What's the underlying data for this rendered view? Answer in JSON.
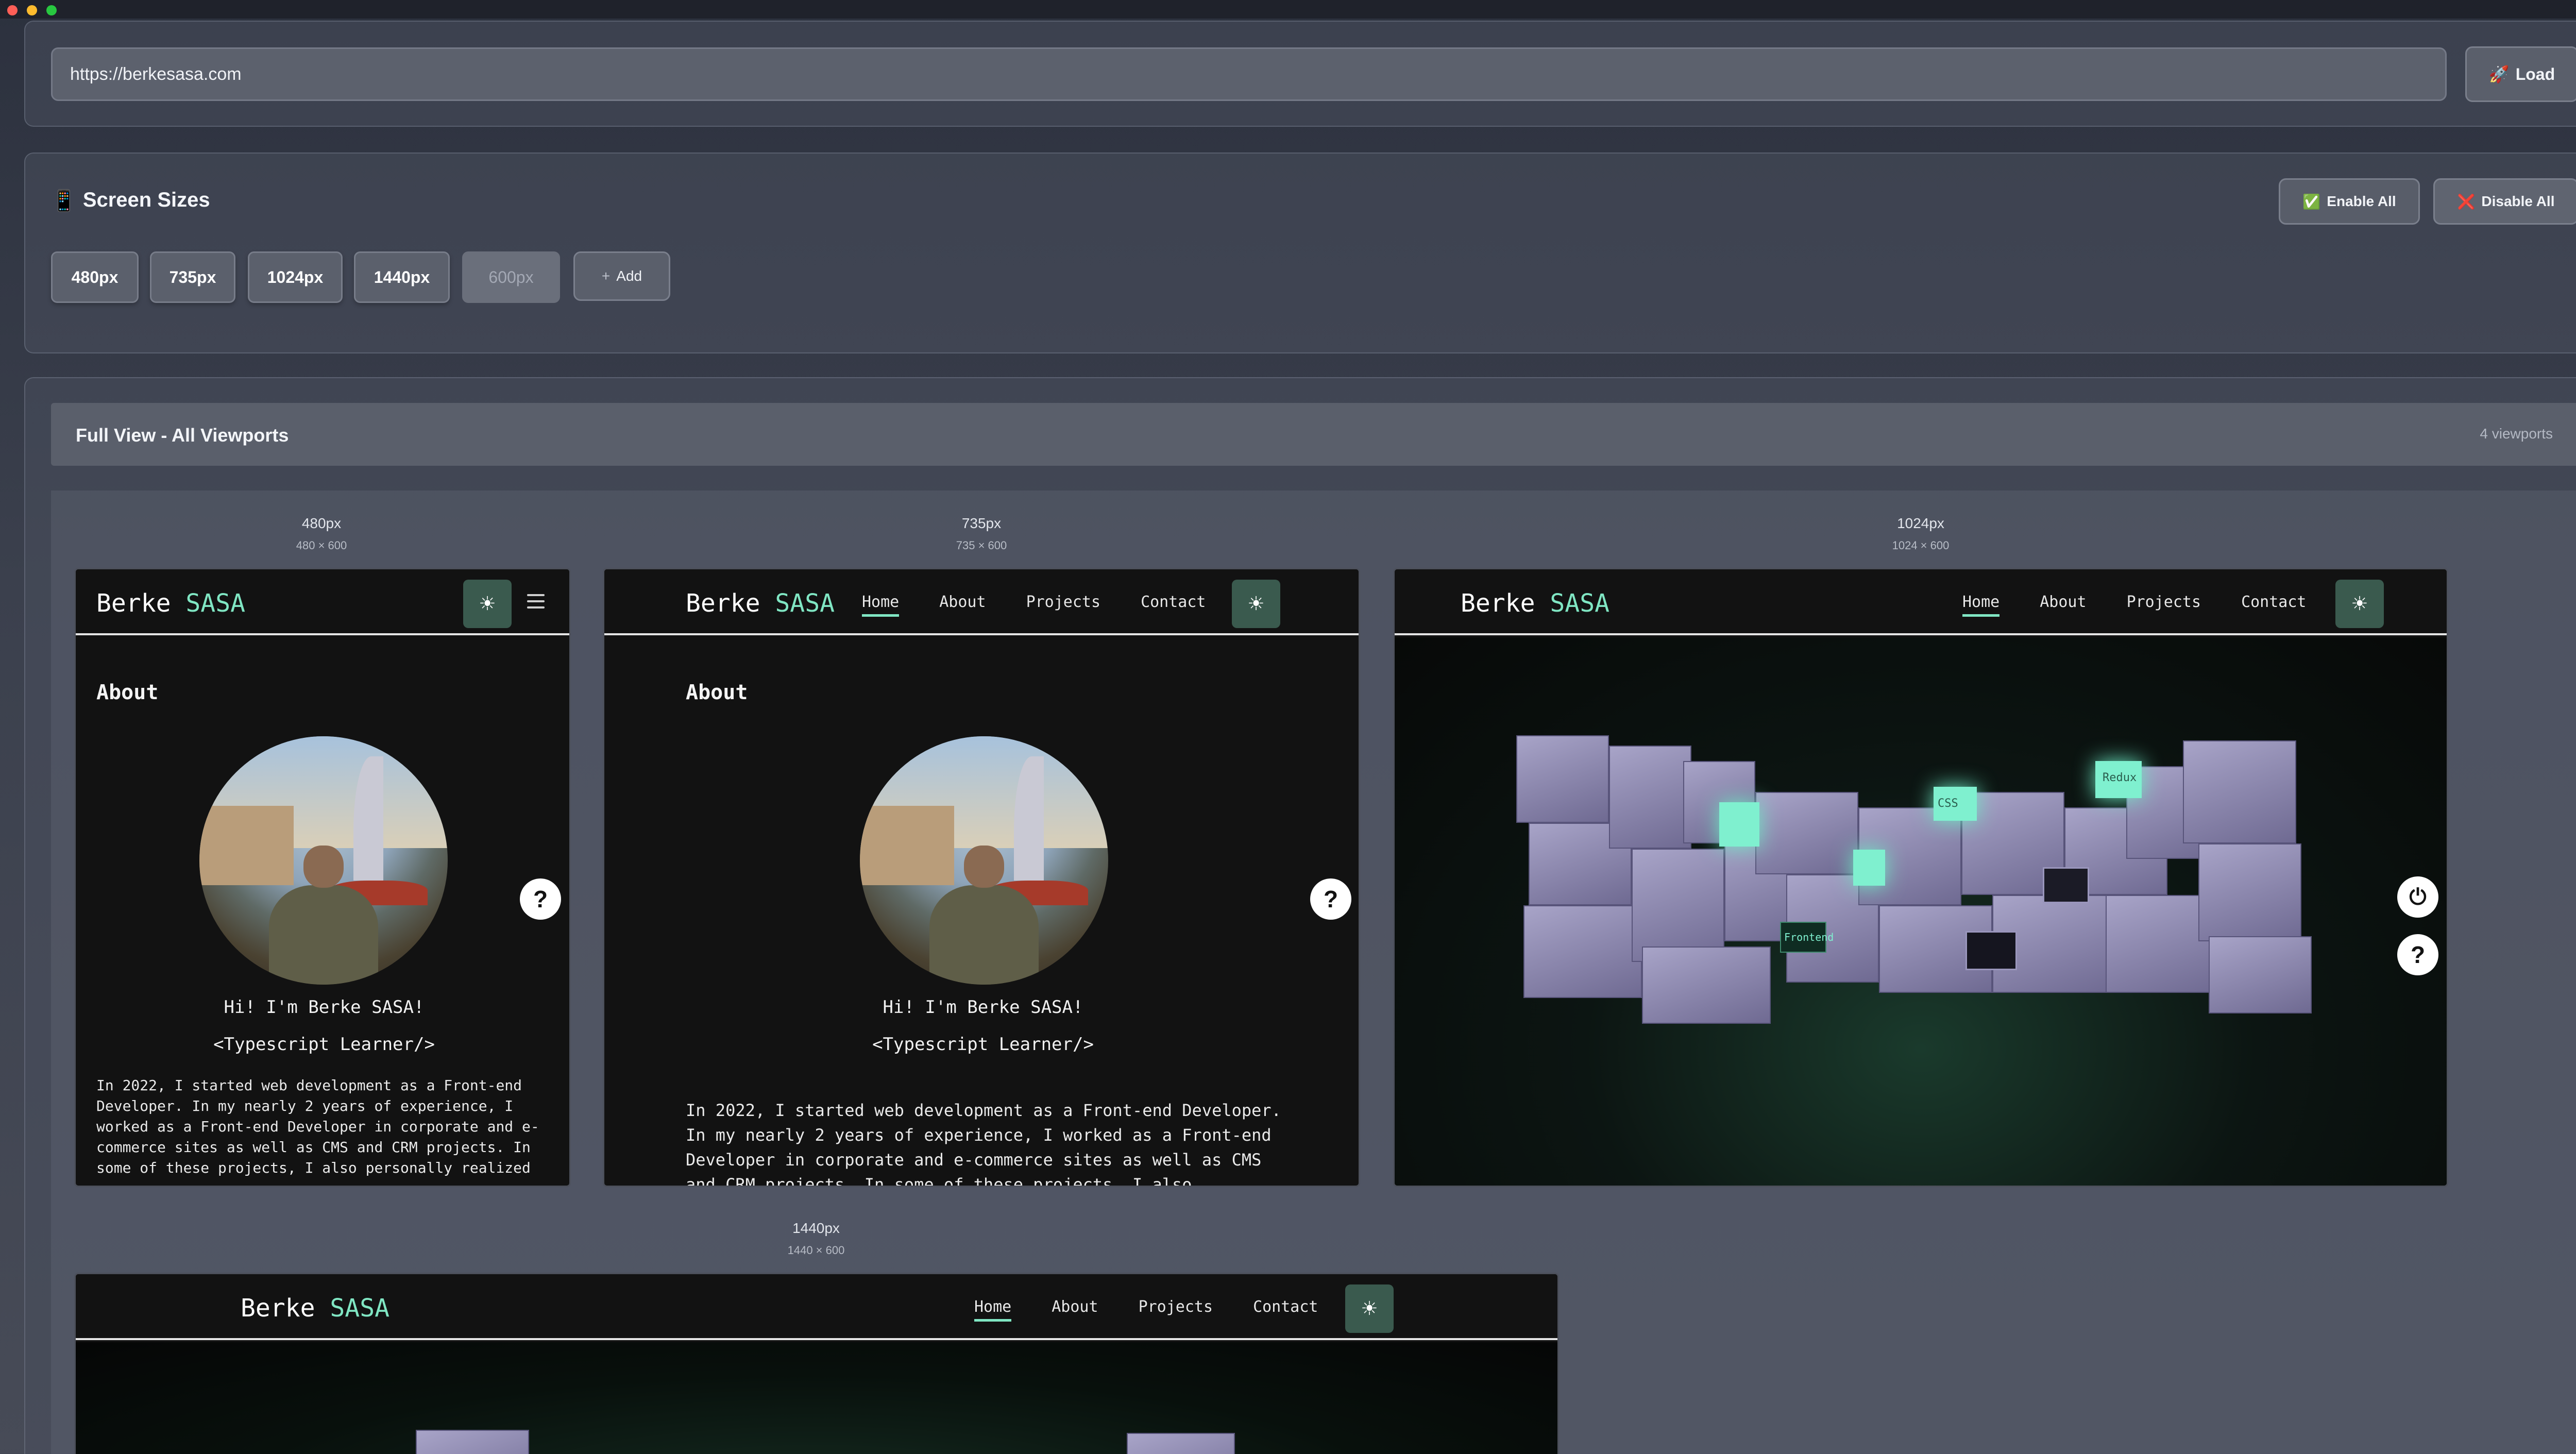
{
  "url_bar": {
    "value": "https://berkesasa.com",
    "load_label": "Load",
    "load_icon": "🚀"
  },
  "screen_sizes": {
    "title": "Screen Sizes",
    "title_icon": "📱",
    "enable_all": "Enable All",
    "enable_icon": "✅",
    "disable_all": "Disable All",
    "disable_icon": "❌",
    "chips": [
      "480px",
      "735px",
      "1024px",
      "1440px"
    ],
    "new_size_placeholder": "600px",
    "add_label": "Add",
    "add_icon": "+"
  },
  "full_view": {
    "title": "Full View - All Viewports",
    "count": "4 viewports"
  },
  "viewports": [
    {
      "name": "480px",
      "dims": "480 × 600"
    },
    {
      "name": "735px",
      "dims": "735 × 600"
    },
    {
      "name": "1024px",
      "dims": "1024 × 600"
    },
    {
      "name": "1440px",
      "dims": "1440 × 600"
    }
  ],
  "site": {
    "logo_first": "Berke",
    "logo_second": "SASA",
    "nav": [
      "Home",
      "About",
      "Projects",
      "Contact"
    ],
    "theme_icon": "☀",
    "about_heading": "About",
    "greeting": "Hi! I'm Berke SASA!",
    "role": "<Typescript Learner/>",
    "bio_small": "In 2022, I started web development as a Front-end Developer. In my nearly 2 years of experience, I worked as a Front-end Developer in corporate and e-commerce sites as well as CMS and CRM projects. In some of these projects, I also personally realized",
    "bio_medium": "In 2022, I started web development as a Front-end Developer. In my nearly 2 years of experience, I worked as a Front-end Developer in corporate and e-commerce sites as well as CMS and CRM projects. In some of these projects, I also",
    "help_icon": "?",
    "power_icon": "⏻",
    "scene_labels": [
      "CSS",
      "Redux",
      "Frontend"
    ]
  },
  "colors": {
    "accent": "#80e6c3",
    "site_bg": "#121212",
    "theme_btn": "#3a5a4e"
  }
}
